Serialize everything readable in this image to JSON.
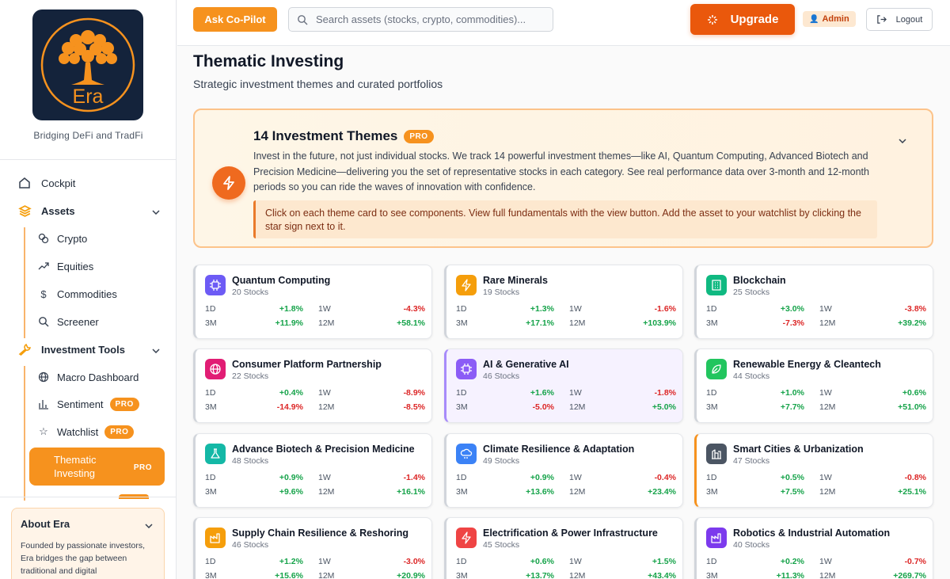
{
  "sidebar": {
    "logo_text": "Era",
    "tagline": "Bridging DeFi and TradFi",
    "nav": {
      "cockpit": "Cockpit",
      "assets": "Assets",
      "crypto": "Crypto",
      "equities": "Equities",
      "commodities": "Commodities",
      "screener": "Screener",
      "investment_tools": "Investment Tools",
      "macro": "Macro Dashboard",
      "sentiment": "Sentiment",
      "watchlist": "Watchlist",
      "thematic": "Thematic Investing",
      "pro": "PRO"
    },
    "about": {
      "title": "About Era",
      "text": "Founded by passionate investors, Era bridges the gap between traditional and digital"
    }
  },
  "topbar": {
    "copilot": "Ask Co-Pilot",
    "search_placeholder": "Search assets (stocks, crypto, commodities)...",
    "upgrade": "Upgrade",
    "admin": "Admin",
    "logout": "Logout"
  },
  "page": {
    "title": "Thematic Investing",
    "subtitle": "Strategic investment themes and curated portfolios"
  },
  "info": {
    "title": "14 Investment Themes",
    "pro": "PRO",
    "description": "Invest in the future, not just individual stocks. We track 14 powerful investment themes—like AI, Quantum Computing, Advanced Biotech and Precision Medicine—delivering you the set of representative stocks in each category. See real performance data over 3-month and 12-month periods so you can ride the waves of innovation with confidence.",
    "note": "Click on each theme card to see components. View full fundamentals with the view button. Add the asset to your watchlist by clicking the star sign next to it."
  },
  "labels": {
    "d1": "1D",
    "w1": "1W",
    "m3": "3M",
    "m12": "12M"
  },
  "themes": [
    {
      "name": "Quantum Computing",
      "stocks": "20 Stocks",
      "d1": "+1.8%",
      "w1": "-4.3%",
      "m3": "+11.9%",
      "m12": "+58.1%",
      "color": "#6d5bf5",
      "icon": "chip-icon"
    },
    {
      "name": "Rare Minerals",
      "stocks": "19 Stocks",
      "d1": "+1.3%",
      "w1": "-1.6%",
      "m3": "+17.1%",
      "m12": "+103.9%",
      "color": "#f59e0b",
      "icon": "bolt-icon"
    },
    {
      "name": "Blockchain",
      "stocks": "25 Stocks",
      "d1": "+3.0%",
      "w1": "-3.8%",
      "m3": "-7.3%",
      "m12": "+39.2%",
      "color": "#10b981",
      "icon": "building-icon"
    },
    {
      "name": "Consumer Platform Partnership",
      "stocks": "22 Stocks",
      "d1": "+0.4%",
      "w1": "-8.9%",
      "m3": "-14.9%",
      "m12": "-8.5%",
      "color": "#e11d74",
      "icon": "globe-icon"
    },
    {
      "name": "AI & Generative AI",
      "stocks": "46 Stocks",
      "d1": "+1.6%",
      "w1": "-1.8%",
      "m3": "-5.0%",
      "m12": "+5.0%",
      "color": "#8b5cf6",
      "icon": "chip-icon"
    },
    {
      "name": "Renewable Energy & Cleantech",
      "stocks": "44 Stocks",
      "d1": "+1.0%",
      "w1": "+0.6%",
      "m3": "+7.7%",
      "m12": "+51.0%",
      "color": "#22c55e",
      "icon": "leaf-icon"
    },
    {
      "name": "Advance Biotech & Precision Medicine",
      "stocks": "48 Stocks",
      "d1": "+0.9%",
      "w1": "-1.4%",
      "m3": "+9.6%",
      "m12": "+16.1%",
      "color": "#14b8a6",
      "icon": "flask-icon"
    },
    {
      "name": "Climate Resilience & Adaptation",
      "stocks": "49 Stocks",
      "d1": "+0.9%",
      "w1": "-0.4%",
      "m3": "+13.6%",
      "m12": "+23.4%",
      "color": "#3b82f6",
      "icon": "cloud-icon"
    },
    {
      "name": "Smart Cities & Urbanization",
      "stocks": "47 Stocks",
      "d1": "+0.5%",
      "w1": "-0.8%",
      "m3": "+7.5%",
      "m12": "+25.1%",
      "color": "#4b5563",
      "icon": "city-icon"
    },
    {
      "name": "Supply Chain Resilience & Reshoring",
      "stocks": "46 Stocks",
      "d1": "+1.2%",
      "w1": "-3.0%",
      "m3": "+15.6%",
      "m12": "+20.9%",
      "color": "#f59e0b",
      "icon": "factory-icon"
    },
    {
      "name": "Electrification & Power Infrastructure",
      "stocks": "45 Stocks",
      "d1": "+0.6%",
      "w1": "+1.5%",
      "m3": "+13.7%",
      "m12": "+43.4%",
      "color": "#ef4444",
      "icon": "bolt-icon"
    },
    {
      "name": "Robotics & Industrial Automation",
      "stocks": "40 Stocks",
      "d1": "+0.2%",
      "w1": "-0.7%",
      "m3": "+11.3%",
      "m12": "+269.7%",
      "color": "#7c3aed",
      "icon": "factory-icon"
    }
  ]
}
